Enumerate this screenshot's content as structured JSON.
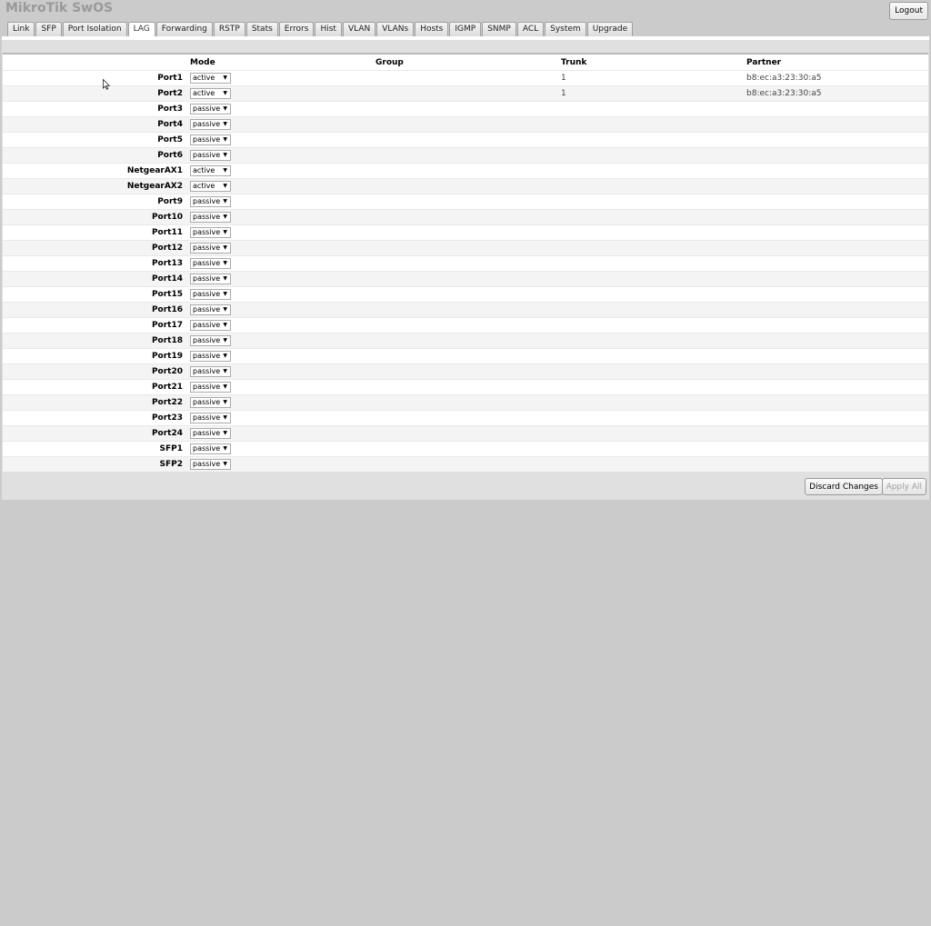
{
  "app": {
    "title": "MikroTik SwOS",
    "logout_label": "Logout"
  },
  "tabs": [
    {
      "label": "Link"
    },
    {
      "label": "SFP"
    },
    {
      "label": "Port Isolation"
    },
    {
      "label": "LAG",
      "active": true
    },
    {
      "label": "Forwarding"
    },
    {
      "label": "RSTP"
    },
    {
      "label": "Stats"
    },
    {
      "label": "Errors"
    },
    {
      "label": "Hist"
    },
    {
      "label": "VLAN"
    },
    {
      "label": "VLANs"
    },
    {
      "label": "Hosts"
    },
    {
      "label": "IGMP"
    },
    {
      "label": "SNMP"
    },
    {
      "label": "ACL"
    },
    {
      "label": "System"
    },
    {
      "label": "Upgrade"
    }
  ],
  "table": {
    "headers": {
      "mode": "Mode",
      "group": "Group",
      "trunk": "Trunk",
      "partner": "Partner"
    },
    "rows": [
      {
        "name": "Port1",
        "mode": "active",
        "group": "",
        "trunk": "1",
        "partner": "b8:ec:a3:23:30:a5"
      },
      {
        "name": "Port2",
        "mode": "active",
        "group": "",
        "trunk": "1",
        "partner": "b8:ec:a3:23:30:a5"
      },
      {
        "name": "Port3",
        "mode": "passive",
        "group": "",
        "trunk": "",
        "partner": ""
      },
      {
        "name": "Port4",
        "mode": "passive",
        "group": "",
        "trunk": "",
        "partner": ""
      },
      {
        "name": "Port5",
        "mode": "passive",
        "group": "",
        "trunk": "",
        "partner": ""
      },
      {
        "name": "Port6",
        "mode": "passive",
        "group": "",
        "trunk": "",
        "partner": ""
      },
      {
        "name": "NetgearAX1",
        "mode": "active",
        "group": "",
        "trunk": "",
        "partner": ""
      },
      {
        "name": "NetgearAX2",
        "mode": "active",
        "group": "",
        "trunk": "",
        "partner": ""
      },
      {
        "name": "Port9",
        "mode": "passive",
        "group": "",
        "trunk": "",
        "partner": ""
      },
      {
        "name": "Port10",
        "mode": "passive",
        "group": "",
        "trunk": "",
        "partner": ""
      },
      {
        "name": "Port11",
        "mode": "passive",
        "group": "",
        "trunk": "",
        "partner": ""
      },
      {
        "name": "Port12",
        "mode": "passive",
        "group": "",
        "trunk": "",
        "partner": ""
      },
      {
        "name": "Port13",
        "mode": "passive",
        "group": "",
        "trunk": "",
        "partner": ""
      },
      {
        "name": "Port14",
        "mode": "passive",
        "group": "",
        "trunk": "",
        "partner": ""
      },
      {
        "name": "Port15",
        "mode": "passive",
        "group": "",
        "trunk": "",
        "partner": ""
      },
      {
        "name": "Port16",
        "mode": "passive",
        "group": "",
        "trunk": "",
        "partner": ""
      },
      {
        "name": "Port17",
        "mode": "passive",
        "group": "",
        "trunk": "",
        "partner": ""
      },
      {
        "name": "Port18",
        "mode": "passive",
        "group": "",
        "trunk": "",
        "partner": ""
      },
      {
        "name": "Port19",
        "mode": "passive",
        "group": "",
        "trunk": "",
        "partner": ""
      },
      {
        "name": "Port20",
        "mode": "passive",
        "group": "",
        "trunk": "",
        "partner": ""
      },
      {
        "name": "Port21",
        "mode": "passive",
        "group": "",
        "trunk": "",
        "partner": ""
      },
      {
        "name": "Port22",
        "mode": "passive",
        "group": "",
        "trunk": "",
        "partner": ""
      },
      {
        "name": "Port23",
        "mode": "passive",
        "group": "",
        "trunk": "",
        "partner": ""
      },
      {
        "name": "Port24",
        "mode": "passive",
        "group": "",
        "trunk": "",
        "partner": ""
      },
      {
        "name": "SFP1",
        "mode": "passive",
        "group": "",
        "trunk": "",
        "partner": ""
      },
      {
        "name": "SFP2",
        "mode": "passive",
        "group": "",
        "trunk": "",
        "partner": ""
      }
    ]
  },
  "footer": {
    "discard_label": "Discard Changes",
    "apply_label": "Apply All"
  },
  "icons": {
    "dropdown": "chevron-down-icon",
    "cursor": "mouse-cursor-icon"
  }
}
